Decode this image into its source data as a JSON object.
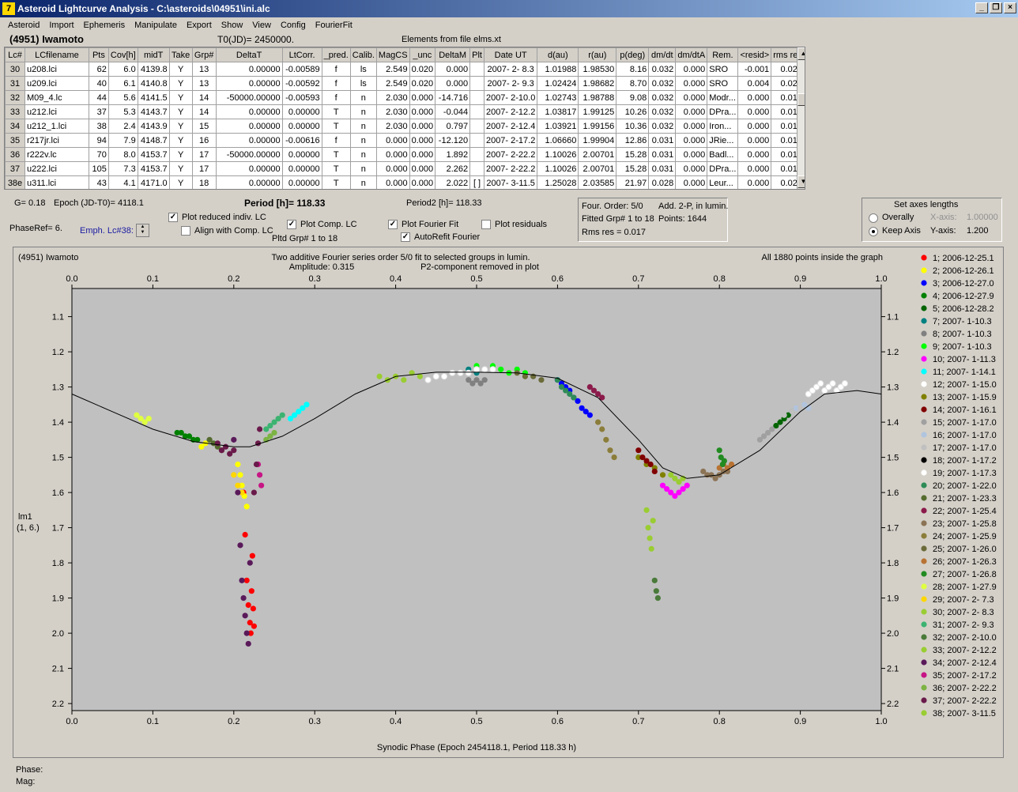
{
  "window": {
    "title": "Asteroid Lightcurve Analysis - C:\\asteroids\\04951\\ini.alc",
    "icon_letter": "7"
  },
  "menu": [
    "Asteroid",
    "Import",
    "Ephemeris",
    "Manipulate",
    "Export",
    "Show",
    "View",
    "Config",
    "FourierFit"
  ],
  "header": {
    "name": "(4951) Iwamoto",
    "t0": "T0(JD)= 2450000.",
    "elements": "Elements from file elms.xt"
  },
  "table": {
    "columns": [
      "Lc#",
      "LCfilename",
      "Pts",
      "Cov[h]",
      "midT",
      "Take",
      "Grp#",
      "DeltaT",
      "LtCorr.",
      "_pred.",
      "Calib.",
      "MagCS",
      "_unc",
      "DeltaM",
      "Plt",
      "Date UT",
      "d(au)",
      "r(au)",
      "p(deg)",
      "dm/dt",
      "dm/dtA",
      "Rem.",
      "<resid>",
      "rms res"
    ],
    "rows": [
      [
        "30",
        "u208.lci",
        "62",
        "6.0",
        "4139.8",
        "Y",
        "13",
        "0.00000",
        "-0.00589",
        "f",
        "ls",
        "2.549",
        "0.020",
        "0.000",
        "",
        "2007- 2- 8.3",
        "1.01988",
        "1.98530",
        "8.16",
        "0.032",
        "0.000",
        "SRO",
        "-0.001",
        "0.023"
      ],
      [
        "31",
        "u209.lci",
        "40",
        "6.1",
        "4140.8",
        "Y",
        "13",
        "0.00000",
        "-0.00592",
        "f",
        "ls",
        "2.549",
        "0.020",
        "0.000",
        "",
        "2007- 2- 9.3",
        "1.02424",
        "1.98682",
        "8.70",
        "0.032",
        "0.000",
        "SRO",
        "0.004",
        "0.026"
      ],
      [
        "32",
        "M09_4.lc",
        "44",
        "5.6",
        "4141.5",
        "Y",
        "14",
        "-50000.00000",
        "-0.00593",
        "f",
        "n",
        "2.030",
        "0.000",
        "-14.716",
        "",
        "2007- 2-10.0",
        "1.02743",
        "1.98788",
        "9.08",
        "0.032",
        "0.000",
        "Modr...",
        "0.000",
        "0.015"
      ],
      [
        "33",
        "u212.lci",
        "37",
        "5.3",
        "4143.7",
        "Y",
        "14",
        "0.00000",
        "0.00000",
        "T",
        "n",
        "2.030",
        "0.000",
        "-0.044",
        "",
        "2007- 2-12.2",
        "1.03817",
        "1.99125",
        "10.26",
        "0.032",
        "0.000",
        "DPra...",
        "0.000",
        "0.016"
      ],
      [
        "34",
        "u212_1.lci",
        "38",
        "2.4",
        "4143.9",
        "Y",
        "15",
        "0.00000",
        "0.00000",
        "T",
        "n",
        "2.030",
        "0.000",
        "0.797",
        "",
        "2007- 2-12.4",
        "1.03921",
        "1.99156",
        "10.36",
        "0.032",
        "0.000",
        "Iron...",
        "0.000",
        "0.015"
      ],
      [
        "35",
        "r217jr.lci",
        "94",
        "7.9",
        "4148.7",
        "Y",
        "16",
        "0.00000",
        "-0.00616",
        "f",
        "n",
        "0.000",
        "0.000",
        "-12.120",
        "",
        "2007- 2-17.2",
        "1.06660",
        "1.99904",
        "12.86",
        "0.031",
        "0.000",
        "JRie...",
        "0.000",
        "0.019"
      ],
      [
        "36",
        "r222v.lc",
        "70",
        "8.0",
        "4153.7",
        "Y",
        "17",
        "-50000.00000",
        "0.00000",
        "T",
        "n",
        "0.000",
        "0.000",
        "1.892",
        "",
        "2007- 2-22.2",
        "1.10026",
        "2.00701",
        "15.28",
        "0.031",
        "0.000",
        "Badl...",
        "0.000",
        "0.014"
      ],
      [
        "37",
        "u222.lci",
        "105",
        "7.3",
        "4153.7",
        "Y",
        "17",
        "0.00000",
        "0.00000",
        "T",
        "n",
        "0.000",
        "0.000",
        "2.262",
        "",
        "2007- 2-22.2",
        "1.10026",
        "2.00701",
        "15.28",
        "0.031",
        "0.000",
        "DPra...",
        "0.000",
        "0.018"
      ],
      [
        "38e",
        "u311.lci",
        "43",
        "4.1",
        "4171.0",
        "Y",
        "18",
        "0.00000",
        "0.00000",
        "T",
        "n",
        "0.000",
        "0.000",
        "2.022",
        "[ ]",
        "2007- 3-11.5",
        "1.25028",
        "2.03585",
        "21.97",
        "0.028",
        "0.000",
        "Leur...",
        "0.000",
        "0.021"
      ]
    ]
  },
  "controls": {
    "g": "G= 0.18",
    "epoch": "Epoch (JD-T0)= 4118.1",
    "period": "Period [h]= 118.33",
    "period2": "Period2 [h]= 118.33",
    "phaseref": "PhaseRef= 6.",
    "emph": "Emph. Lc#38:",
    "plot_reduced": "Plot reduced indiv. LC",
    "align": "Align with Comp. LC",
    "plot_comp": "Plot Comp. LC",
    "pltd_grp": "Pltd Grp#  1   to   18",
    "plot_fourier": "Plot Fourier Fit",
    "autorefit": "AutoRefit Fourier",
    "plot_residuals": "Plot residuals",
    "four_order": "Four. Order:  5/0",
    "add_2p": "Add. 2-P, in lumin.",
    "fitted_grp": "Fitted Grp# 1 to 18",
    "points": "Points: 1644",
    "rms": "Rms res     = 0.017",
    "axes_title": "Set axes lengths",
    "overally": "Overally",
    "keep_axis": "Keep Axis",
    "x_axis_label": "X-axis:",
    "x_axis_val": "1.00000",
    "y_axis_label": "Y-axis:",
    "y_axis_val": "1.200"
  },
  "chart_data": {
    "type": "scatter",
    "title_left": "(4951) Iwamoto",
    "title": "Two additive Fourier series order 5/0 fit to selected groups in lumin.",
    "amplitude": "Amplitude: 0.315",
    "p2note": "P2-component removed in plot",
    "title_right": "All 1880 points inside the graph",
    "xlabel": "Synodic Phase (Epoch 2454118.1, Period 118.33 h)",
    "ylabel": "lm1",
    "ylabel2": "(1, 6.)",
    "xlim": [
      0,
      1
    ],
    "ylim": [
      1.02,
      2.22
    ],
    "y_inverted": true,
    "xticks": [
      "0.0",
      "0.1",
      "0.2",
      "0.3",
      "0.4",
      "0.5",
      "0.6",
      "0.7",
      "0.8",
      "0.9",
      "1.0"
    ],
    "yticks": [
      "1.1",
      "1.2",
      "1.3",
      "1.4",
      "1.5",
      "1.6",
      "1.7",
      "1.8",
      "1.9",
      "2.0",
      "2.1",
      "2.2"
    ],
    "fit_curve": [
      [
        0,
        1.32
      ],
      [
        0.05,
        1.37
      ],
      [
        0.1,
        1.42
      ],
      [
        0.15,
        1.455
      ],
      [
        0.2,
        1.47
      ],
      [
        0.22,
        1.47
      ],
      [
        0.26,
        1.44
      ],
      [
        0.3,
        1.39
      ],
      [
        0.35,
        1.32
      ],
      [
        0.4,
        1.27
      ],
      [
        0.45,
        1.258
      ],
      [
        0.5,
        1.258
      ],
      [
        0.55,
        1.26
      ],
      [
        0.6,
        1.275
      ],
      [
        0.65,
        1.33
      ],
      [
        0.7,
        1.45
      ],
      [
        0.73,
        1.53
      ],
      [
        0.76,
        1.56
      ],
      [
        0.8,
        1.55
      ],
      [
        0.85,
        1.48
      ],
      [
        0.9,
        1.37
      ],
      [
        0.93,
        1.32
      ],
      [
        0.97,
        1.31
      ],
      [
        1.0,
        1.32
      ]
    ],
    "series": [
      {
        "name": "1; 2006-12-25.1",
        "color": "#ff0000",
        "x": [
          0.212,
          0.214,
          0.216,
          0.218,
          0.22,
          0.221,
          0.222,
          0.223,
          0.224,
          0.225
        ],
        "y": [
          1.6,
          1.72,
          1.85,
          1.92,
          1.97,
          2.0,
          1.88,
          1.78,
          1.93,
          1.98
        ]
      },
      {
        "name": "2; 2006-12-26.1",
        "color": "#ffff00",
        "x": [
          0.16,
          0.165,
          0.205,
          0.208,
          0.21,
          0.213,
          0.216
        ],
        "y": [
          1.47,
          1.46,
          1.52,
          1.55,
          1.58,
          1.61,
          1.64
        ]
      },
      {
        "name": "3; 2006-12-27.0",
        "color": "#0000ff",
        "x": [
          0.6,
          0.605,
          0.61,
          0.615,
          0.62,
          0.625,
          0.63,
          0.635,
          0.64
        ],
        "y": [
          1.28,
          1.29,
          1.3,
          1.31,
          1.33,
          1.34,
          1.36,
          1.37,
          1.38
        ]
      },
      {
        "name": "4; 2006-12-27.9",
        "color": "#008000",
        "x": [
          0.13,
          0.135,
          0.14,
          0.145,
          0.15,
          0.155
        ],
        "y": [
          1.43,
          1.43,
          1.44,
          1.44,
          1.45,
          1.45
        ]
      },
      {
        "name": "5; 2006-12-28.2",
        "color": "#006400",
        "x": [
          0.87,
          0.875,
          0.88,
          0.885,
          0.89
        ],
        "y": [
          1.41,
          1.4,
          1.39,
          1.38,
          1.37
        ]
      },
      {
        "name": "7; 2007- 1-10.3",
        "color": "#008080",
        "x": [
          0.49,
          0.5,
          0.51
        ],
        "y": [
          1.25,
          1.26,
          1.25
        ]
      },
      {
        "name": "8; 2007- 1-10.3",
        "color": "#808080",
        "x": [
          0.49,
          0.495,
          0.5,
          0.505,
          0.51
        ],
        "y": [
          1.28,
          1.29,
          1.28,
          1.29,
          1.28
        ]
      },
      {
        "name": "9; 2007- 1-10.3",
        "color": "#00ff00",
        "x": [
          0.5,
          0.51,
          0.52,
          0.53,
          0.54,
          0.55,
          0.56
        ],
        "y": [
          1.24,
          1.25,
          1.24,
          1.25,
          1.26,
          1.25,
          1.26
        ]
      },
      {
        "name": "10; 2007- 1-11.3",
        "color": "#ff00ff",
        "x": [
          0.73,
          0.735,
          0.74,
          0.745,
          0.75,
          0.755,
          0.76
        ],
        "y": [
          1.58,
          1.59,
          1.6,
          1.61,
          1.6,
          1.59,
          1.58
        ]
      },
      {
        "name": "11; 2007- 1-14.1",
        "color": "#00ffff",
        "x": [
          0.27,
          0.275,
          0.28,
          0.285,
          0.29
        ],
        "y": [
          1.39,
          1.38,
          1.37,
          1.36,
          1.35
        ]
      },
      {
        "name": "12; 2007- 1-15.0",
        "color": "#ffffff",
        "x": [
          0.44,
          0.45,
          0.46,
          0.47,
          0.48,
          0.49,
          0.5,
          0.51,
          0.52
        ],
        "y": [
          1.28,
          1.27,
          1.27,
          1.26,
          1.26,
          1.26,
          1.25,
          1.25,
          1.25
        ]
      },
      {
        "name": "13; 2007- 1-15.9",
        "color": "#808000",
        "x": [
          0.7,
          0.71,
          0.72,
          0.73
        ],
        "y": [
          1.5,
          1.52,
          1.53,
          1.55
        ]
      },
      {
        "name": "14; 2007- 1-16.1",
        "color": "#800000",
        "x": [
          0.7,
          0.705,
          0.71,
          0.715,
          0.72
        ],
        "y": [
          1.48,
          1.5,
          1.51,
          1.52,
          1.54
        ]
      },
      {
        "name": "15; 2007- 1-17.0",
        "color": "#a0a0a0",
        "x": [
          0.85,
          0.855,
          0.86,
          0.865
        ],
        "y": [
          1.45,
          1.44,
          1.43,
          1.42
        ]
      },
      {
        "name": "16; 2007- 1-17.0",
        "color": "#b0c4de",
        "x": [
          0.89,
          0.895,
          0.9,
          0.905,
          0.91
        ],
        "y": [
          1.37,
          1.36,
          1.36,
          1.35,
          1.36
        ]
      },
      {
        "name": "17; 2007- 1-17.0",
        "color": "#c0c0c0",
        "x": [
          0.86,
          0.87,
          0.88,
          0.89,
          0.9
        ],
        "y": [
          1.4,
          1.39,
          1.38,
          1.37,
          1.36
        ]
      },
      {
        "name": "18; 2007- 1-17.2",
        "color": "#000000",
        "x": [
          0.92
        ],
        "y": [
          1.3
        ]
      },
      {
        "name": "19; 2007- 1-17.3",
        "color": "#ffffff",
        "x": [
          0.91,
          0.915,
          0.92,
          0.925,
          0.93,
          0.935,
          0.94,
          0.945,
          0.95,
          0.955
        ],
        "y": [
          1.32,
          1.31,
          1.3,
          1.29,
          1.31,
          1.3,
          1.29,
          1.31,
          1.3,
          1.29
        ]
      },
      {
        "name": "20; 2007- 1-22.0",
        "color": "#2e8b57",
        "x": [
          0.6,
          0.605,
          0.61,
          0.615,
          0.62
        ],
        "y": [
          1.28,
          1.3,
          1.31,
          1.32,
          1.33
        ]
      },
      {
        "name": "21; 2007- 1-23.3",
        "color": "#556b2f",
        "x": [
          0.17,
          0.175,
          0.18,
          0.185
        ],
        "y": [
          1.45,
          1.46,
          1.47,
          1.48
        ]
      },
      {
        "name": "22; 2007- 1-25.4",
        "color": "#8b1a4a",
        "x": [
          0.64,
          0.645,
          0.65,
          0.655
        ],
        "y": [
          1.3,
          1.31,
          1.32,
          1.33
        ]
      },
      {
        "name": "23; 2007- 1-25.8",
        "color": "#8b7355",
        "x": [
          0.78,
          0.785,
          0.79,
          0.795,
          0.8,
          0.805,
          0.81
        ],
        "y": [
          1.54,
          1.55,
          1.55,
          1.56,
          1.55,
          1.54,
          1.54
        ]
      },
      {
        "name": "24; 2007- 1-25.9",
        "color": "#8b7d3a",
        "x": [
          0.65,
          0.655,
          0.66,
          0.665,
          0.67
        ],
        "y": [
          1.4,
          1.42,
          1.45,
          1.48,
          1.5
        ]
      },
      {
        "name": "25; 2007- 1-26.0",
        "color": "#6b6b3a",
        "x": [
          0.55,
          0.56,
          0.57,
          0.58
        ],
        "y": [
          1.26,
          1.27,
          1.27,
          1.28
        ]
      },
      {
        "name": "26; 2007- 1-26.3",
        "color": "#b87333",
        "x": [
          0.8,
          0.805,
          0.81,
          0.815
        ],
        "y": [
          1.53,
          1.52,
          1.53,
          1.52
        ]
      },
      {
        "name": "27; 2007- 1-26.8",
        "color": "#228b22",
        "x": [
          0.8,
          0.802,
          0.804,
          0.806
        ],
        "y": [
          1.48,
          1.5,
          1.52,
          1.51
        ]
      },
      {
        "name": "28; 2007- 1-27.9",
        "color": "#e0ff40",
        "x": [
          0.08,
          0.085,
          0.09,
          0.095
        ],
        "y": [
          1.38,
          1.39,
          1.4,
          1.39
        ]
      },
      {
        "name": "29; 2007- 2- 7.3",
        "color": "#ffd700",
        "x": [
          0.2,
          0.205,
          0.21
        ],
        "y": [
          1.55,
          1.58,
          1.6
        ]
      },
      {
        "name": "30; 2007- 2- 8.3",
        "color": "#9acd32",
        "x": [
          0.38,
          0.39,
          0.4,
          0.41,
          0.42,
          0.43
        ],
        "y": [
          1.27,
          1.28,
          1.27,
          1.28,
          1.26,
          1.27
        ]
      },
      {
        "name": "31; 2007- 2- 9.3",
        "color": "#3cb371",
        "x": [
          0.24,
          0.245,
          0.25,
          0.255,
          0.26
        ],
        "y": [
          1.42,
          1.41,
          1.4,
          1.39,
          1.38
        ]
      },
      {
        "name": "32; 2007- 2-10.0",
        "color": "#4a7a3a",
        "x": [
          0.72,
          0.722,
          0.724
        ],
        "y": [
          1.85,
          1.88,
          1.9
        ]
      },
      {
        "name": "33; 2007- 2-12.2",
        "color": "#9acd32",
        "x": [
          0.71,
          0.712,
          0.714,
          0.716,
          0.718
        ],
        "y": [
          1.65,
          1.7,
          1.73,
          1.76,
          1.68
        ]
      },
      {
        "name": "34; 2007- 2-12.4",
        "color": "#5a1a5a",
        "x": [
          0.2,
          0.205,
          0.208,
          0.21,
          0.212,
          0.214,
          0.216,
          0.218,
          0.22
        ],
        "y": [
          1.45,
          1.6,
          1.75,
          1.85,
          1.9,
          1.95,
          2.0,
          2.03,
          1.8
        ]
      },
      {
        "name": "35; 2007- 2-17.2",
        "color": "#c71585",
        "x": [
          0.23,
          0.232,
          0.234
        ],
        "y": [
          1.52,
          1.55,
          1.58
        ]
      },
      {
        "name": "36; 2007- 2-22.2",
        "color": "#7cb342",
        "x": [
          0.24,
          0.245,
          0.25
        ],
        "y": [
          1.45,
          1.44,
          1.43
        ]
      },
      {
        "name": "37; 2007- 2-22.2",
        "color": "#6a1a4a",
        "x": [
          0.18,
          0.185,
          0.19,
          0.195,
          0.2,
          0.225,
          0.228,
          0.23,
          0.232
        ],
        "y": [
          1.46,
          1.48,
          1.47,
          1.49,
          1.48,
          1.6,
          1.52,
          1.46,
          1.42
        ]
      },
      {
        "name": "38; 2007- 3-11.5",
        "color": "#9acd32",
        "x": [
          0.74,
          0.745,
          0.75,
          0.755
        ],
        "y": [
          1.55,
          1.56,
          1.57,
          1.56
        ]
      }
    ]
  },
  "footer": {
    "phase": "Phase:",
    "mag": "Mag:"
  }
}
